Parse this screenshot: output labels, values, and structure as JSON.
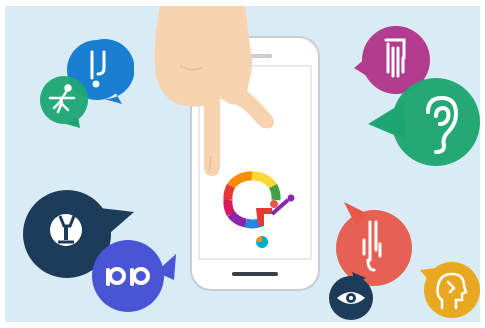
{
  "scene": {
    "background_color": "#d9ecf6",
    "phone": {
      "body_color": "#ffffff",
      "frame_color": "#c9ccd0",
      "screen_color": "#ffffff",
      "logo": {
        "ring_colors": [
          "#e53935",
          "#fb8c00",
          "#fdd835",
          "#43a047",
          "#00acc1",
          "#1e88e5",
          "#8e24aa",
          "#d81b60"
        ],
        "icon_name": "question-mark-accessibility-logo"
      }
    },
    "hand": {
      "skin_color": "#f7d3b0",
      "icon_name": "pointing-hand"
    },
    "bubbles": [
      {
        "icon_name": "cane-icon",
        "color": "#1a7fd1"
      },
      {
        "icon_name": "elderly-person-icon",
        "color": "#1ea672"
      },
      {
        "icon_name": "wheelchair-user-icon",
        "color": "#1d3c5a"
      },
      {
        "icon_name": "baby-carriage-icon",
        "color": "#4a55d6"
      },
      {
        "icon_name": "hand-sign-icon",
        "color": "#b23c8e"
      },
      {
        "icon_name": "ear-icon",
        "color": "#1ea672"
      },
      {
        "icon_name": "mobility-aid-icon",
        "color": "#e8584b"
      },
      {
        "icon_name": "eye-icon",
        "color": "#1d3c5a"
      },
      {
        "icon_name": "head-profile-icon",
        "color": "#e8a821"
      }
    ]
  }
}
